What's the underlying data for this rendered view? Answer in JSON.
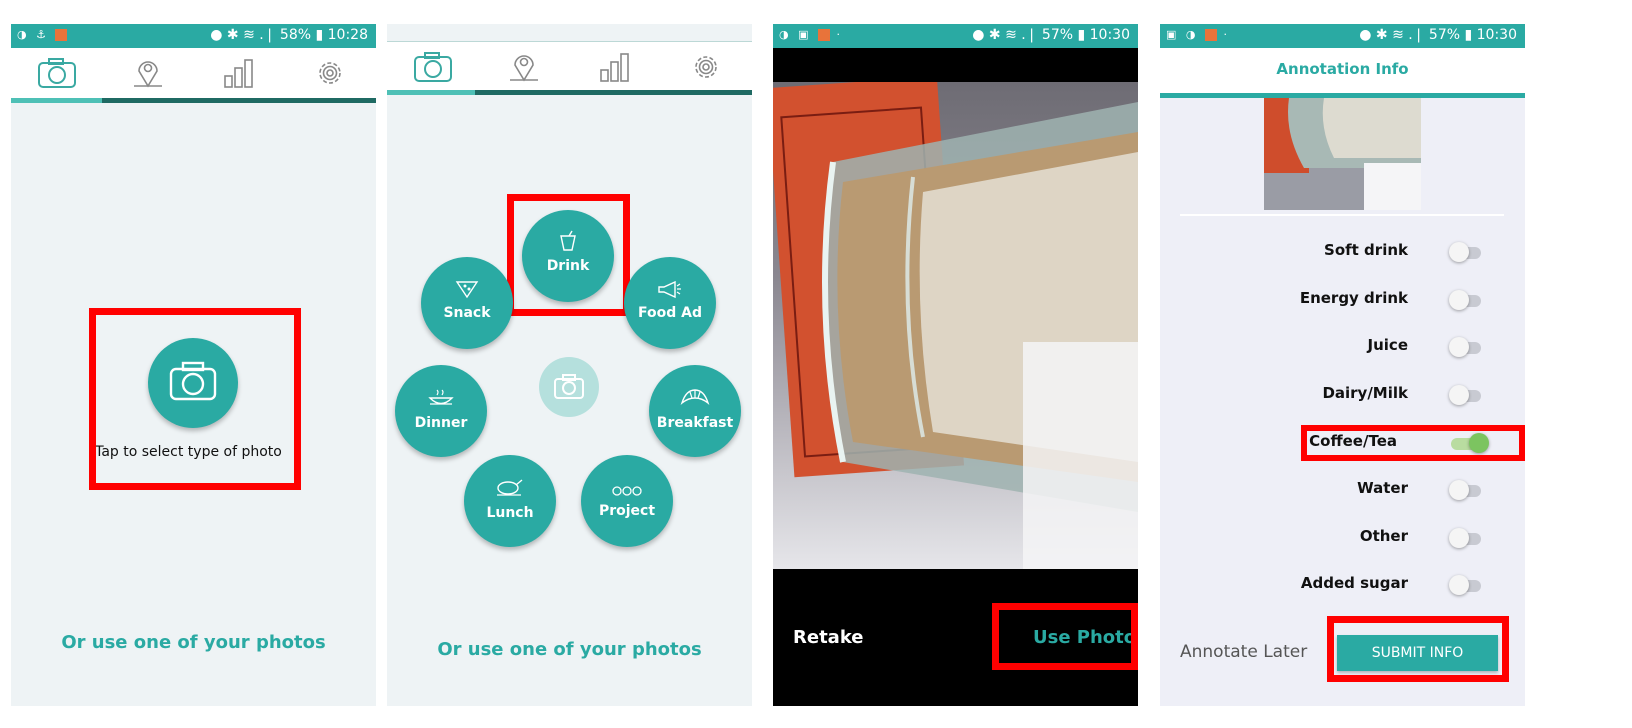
{
  "status_bars": [
    {
      "left_icons": "◑ ⚓",
      "right": "● ✱ ≋ .❘ 58% ▮ 10:28"
    },
    {
      "left_icons": "◑ ▣",
      "right": "● ✱ ≋ .❘ 57% ▮ 10:30"
    },
    {
      "left_icons": "▣ ◑",
      "right": "● ✱ ≋ .❘ 57% ▮ 10:30"
    }
  ],
  "screen1": {
    "center_label": "Tap to select type of photo",
    "bottom_link": "Or use one of your photos"
  },
  "screen2": {
    "types": [
      "Drink",
      "Snack",
      "Food Ad",
      "Dinner",
      "Breakfast",
      "Lunch",
      "Project"
    ],
    "bottom_link": "Or use one of your photos"
  },
  "screen3": {
    "retake": "Retake",
    "use_photo": "Use Photo"
  },
  "screen4": {
    "header_title": "Annotation Info",
    "options": [
      "Soft drink",
      "Energy drink",
      "Juice",
      "Dairy/Milk",
      "Coffee/Tea",
      "Water",
      "Other",
      "Added sugar"
    ],
    "selected_option": "Coffee/Tea",
    "annotate_later": "Annotate Later",
    "submit": "SUBMIT INFO"
  },
  "colors": {
    "teal": "#2aaaa3",
    "highlight": "#ff0000",
    "toggle_on": "#7cc460"
  }
}
